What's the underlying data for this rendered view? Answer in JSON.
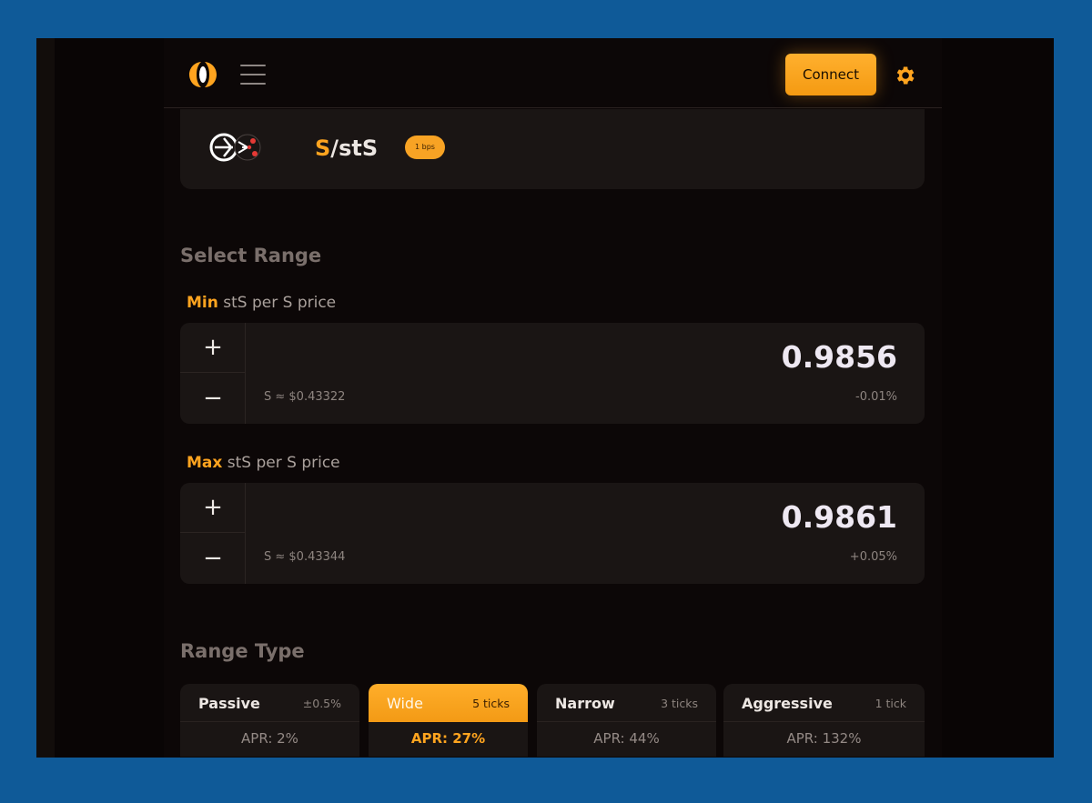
{
  "header": {
    "logo_icon": "logo-icon",
    "menu_icon": "hamburger-menu-icon",
    "connect_label": "Connect",
    "settings_icon": "gear-icon",
    "accent_color": "#f8a324"
  },
  "pair": {
    "base": "S",
    "separator": "/",
    "quote": "stS",
    "fee_badge": "1 bps",
    "pair_icon": "token-pair-icon"
  },
  "select_range": {
    "title": "Select Range",
    "min": {
      "label_prefix": "Min",
      "label_suffix": " stS per S price",
      "value": "0.9856",
      "usd_ref": "S ≈ $0.43322",
      "pct_change": "-0.01%",
      "increment_icon": "plus-icon",
      "decrement_icon": "minus-icon"
    },
    "max": {
      "label_prefix": "Max",
      "label_suffix": " stS per S price",
      "value": "0.9861",
      "usd_ref": "S ≈ $0.43344",
      "pct_change": "+0.05%",
      "increment_icon": "plus-icon",
      "decrement_icon": "minus-icon"
    }
  },
  "range_type": {
    "title": "Range Type",
    "options": [
      {
        "name": "Passive",
        "meta": "±0.5%",
        "apr": "APR: 2%",
        "active": false
      },
      {
        "name": "Wide",
        "meta": "5 ticks",
        "apr": "APR: 27%",
        "active": true
      },
      {
        "name": "Narrow",
        "meta": "3 ticks",
        "apr": "APR: 44%",
        "active": false
      },
      {
        "name": "Aggressive",
        "meta": "1 tick",
        "apr": "APR: 132%",
        "active": false
      }
    ]
  }
}
